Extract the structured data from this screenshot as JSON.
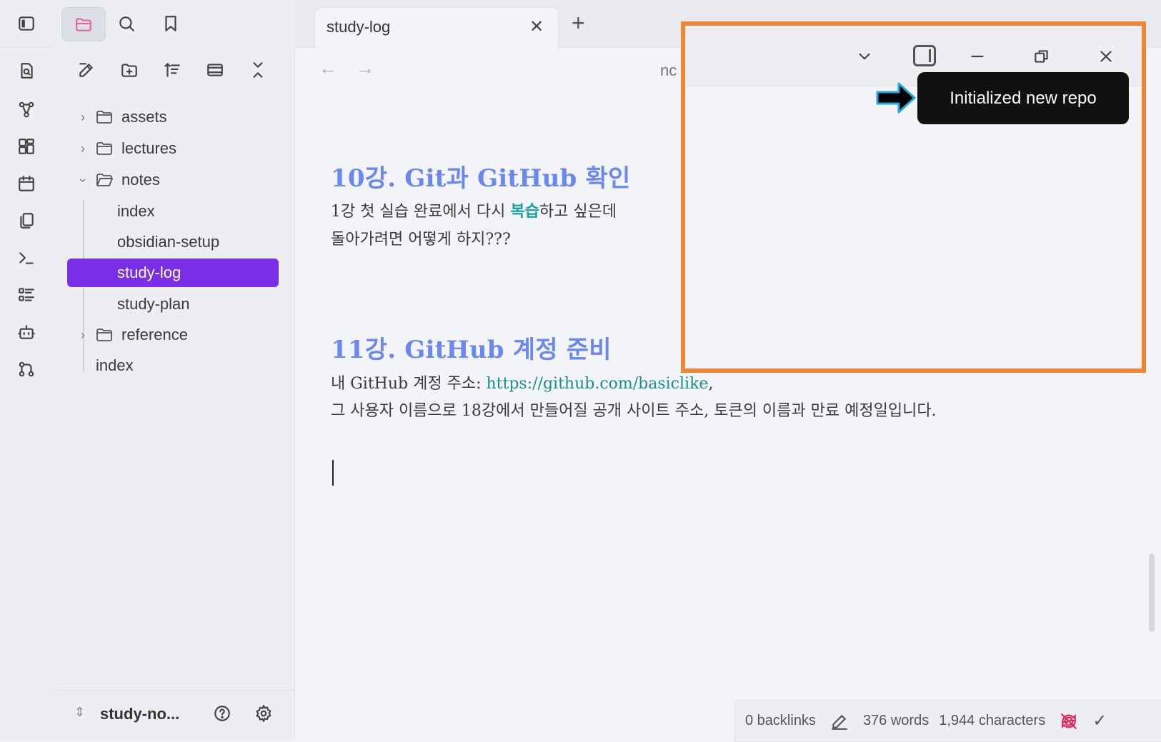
{
  "tab": {
    "title": "study-log",
    "close": "✕",
    "new_tab": "+"
  },
  "nav": {
    "back": "←",
    "forward": "→",
    "breadcrumb_partial": "nc"
  },
  "file_tree": {
    "items": [
      {
        "label": "assets",
        "type": "folder",
        "expanded": false
      },
      {
        "label": "lectures",
        "type": "folder",
        "expanded": false
      },
      {
        "label": "notes",
        "type": "folder",
        "expanded": true
      },
      {
        "label": "index",
        "type": "file"
      },
      {
        "label": "obsidian-setup",
        "type": "file"
      },
      {
        "label": "study-log",
        "type": "file",
        "active": true
      },
      {
        "label": "study-plan",
        "type": "file"
      },
      {
        "label": "reference",
        "type": "folder",
        "expanded": false
      },
      {
        "label": "index",
        "type": "file"
      }
    ]
  },
  "vault": {
    "name": "study-no..."
  },
  "editor": {
    "heading1": "10강. Git과 GitHub 확인",
    "para1_a": "1강 첫 실습 완료에서 다시 ",
    "para1_b": "복습",
    "para1_c": "하고 싶은데",
    "para1_line2": "돌아가려면 어떻게 하지???",
    "heading2": "11강. GitHub 계정 준비",
    "para2_a": "내 GitHub 계정 주소: ",
    "para2_link": "https://github.com/basiclike",
    "para2_b": ",",
    "para2_line2": "그 사용자 이름으로 18강에서 만들어질 공개 사이트 주소, 토큰의 이름과 만료 예정일입니다."
  },
  "status_bar": {
    "backlinks": "0 backlinks",
    "words": "376 words",
    "characters": "1,944 characters"
  },
  "tooltip": {
    "text": "Initialized new repo"
  },
  "colors": {
    "accent": "#7a2fe6",
    "heading": "#6b87f0",
    "teal": "#1aa0a0",
    "highlight_border": "#f08534",
    "arrow_outline": "#22a8e0"
  }
}
